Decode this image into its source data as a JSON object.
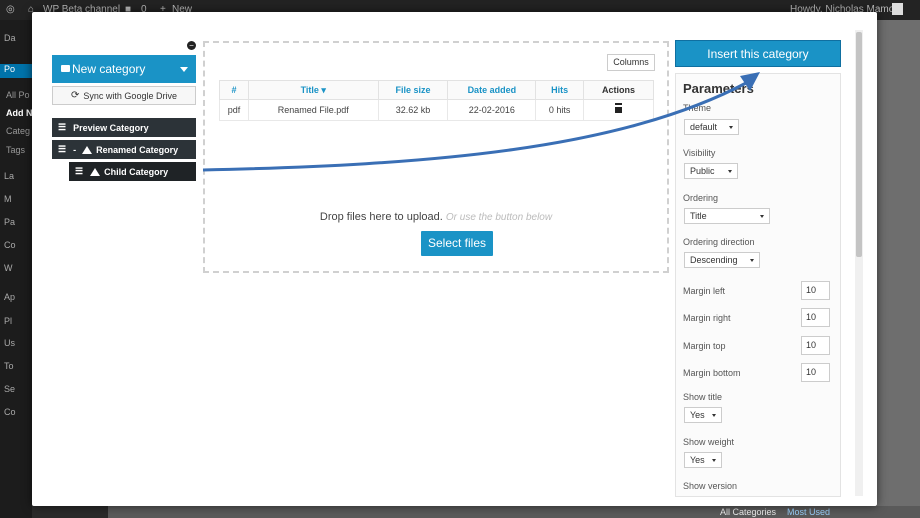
{
  "admin_bar": {
    "site_name": "WP Beta channel",
    "comments_count": "0",
    "new_label": "New",
    "howdy": "Howdy, Nicholas Mamo"
  },
  "wp_menu": [
    "Da",
    "Po",
    "All Po",
    "Add N",
    "Categ",
    "Tags",
    "La",
    "M",
    "Pa",
    "Co",
    "W",
    "Ap",
    "Pl",
    "Us",
    "To",
    "Se",
    "Co"
  ],
  "wp_footer": {
    "all_categories": "All Categories",
    "most_used": "Most Used"
  },
  "left_panel": {
    "new_category": "New category",
    "sync_label": "Sync with Google Drive",
    "categories": [
      {
        "label": "Preview Category"
      },
      {
        "label": "Renamed Category"
      },
      {
        "label": "Child Category"
      }
    ]
  },
  "files": {
    "columns_button": "Columns",
    "headers": [
      "#",
      "Title ▾",
      "File size",
      "Date added",
      "Hits",
      "Actions"
    ],
    "rows": [
      {
        "type": "pdf",
        "title": "Renamed File.pdf",
        "size": "32.62 kb",
        "date": "22-02-2016",
        "hits": "0 hits"
      }
    ],
    "drop_text": "Drop files here to upload.",
    "drop_hint": "Or use the button below",
    "select_files": "Select files"
  },
  "insert_button": "Insert this category",
  "parameters": {
    "title": "Parameters",
    "theme_label": "Theme",
    "theme_value": "default",
    "visibility_label": "Visibility",
    "visibility_value": "Public",
    "ordering_label": "Ordering",
    "ordering_value": "Title",
    "ordering_dir_label": "Ordering direction",
    "ordering_dir_value": "Descending",
    "margin_left_label": "Margin left",
    "margin_left_value": "10",
    "margin_right_label": "Margin right",
    "margin_right_value": "10",
    "margin_top_label": "Margin top",
    "margin_top_value": "10",
    "margin_bottom_label": "Margin bottom",
    "margin_bottom_value": "10",
    "show_title_label": "Show title",
    "show_title_value": "Yes",
    "show_weight_label": "Show weight",
    "show_weight_value": "Yes",
    "show_version_label": "Show version"
  },
  "colors": {
    "primary": "#1a93c6",
    "category_bg": "#2c3338",
    "arrow": "#3a6fb5"
  },
  "icons": {
    "folder": "folder-icon",
    "sync": "sync-icon",
    "drive": "google-drive-icon",
    "handle": "drag-handle-icon",
    "trash": "trash-icon"
  }
}
